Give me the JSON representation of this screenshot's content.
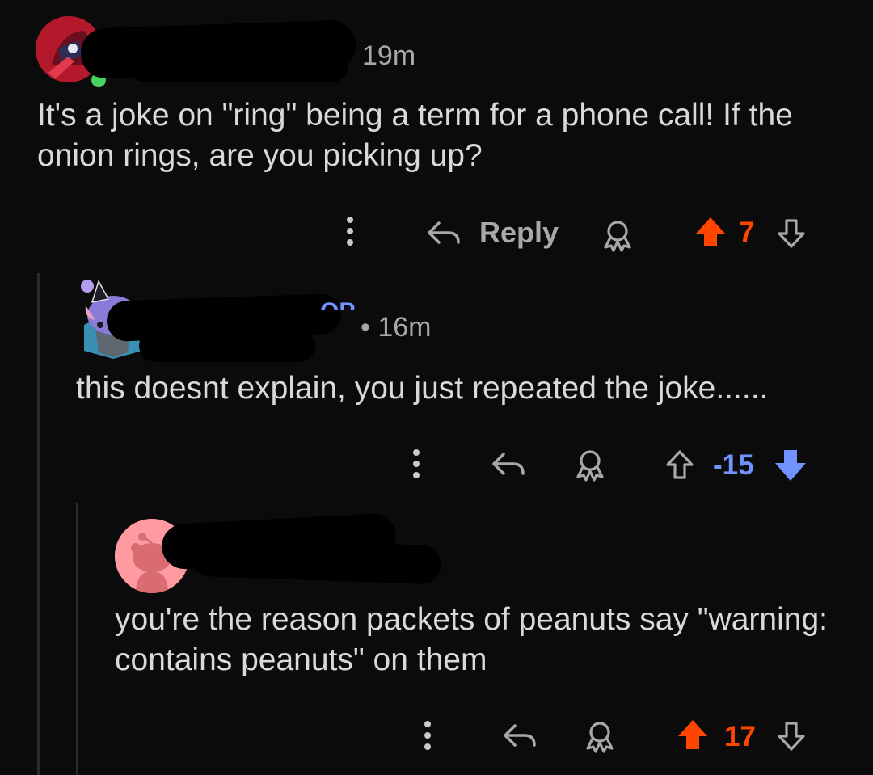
{
  "colors": {
    "upvote": "#ff4500",
    "downvote": "#7193ff",
    "muted": "#a6a8ab",
    "background": "#0b0b0c"
  },
  "comments": [
    {
      "author_tag": "",
      "time": "19m",
      "body": "It's a joke on \"ring\" being a term for a phone call! If the onion rings, are you picking up?",
      "reply_label": "Reply",
      "score": "7",
      "vote_state": "upvoted"
    },
    {
      "author_tag": "OP",
      "time": "• 16m",
      "body": "this doesnt explain, you just repeated the joke......",
      "score": "-15",
      "vote_state": "downvoted"
    },
    {
      "author_tag": "",
      "time": "",
      "body": "you're the reason packets of peanuts say \"warning: contains peanuts\" on them",
      "score": "17",
      "vote_state": "upvoted"
    }
  ],
  "icons": [
    "more-options-icon",
    "reply-arrow-icon",
    "award-icon",
    "upvote-icon",
    "downvote-icon",
    "online-status-icon"
  ]
}
